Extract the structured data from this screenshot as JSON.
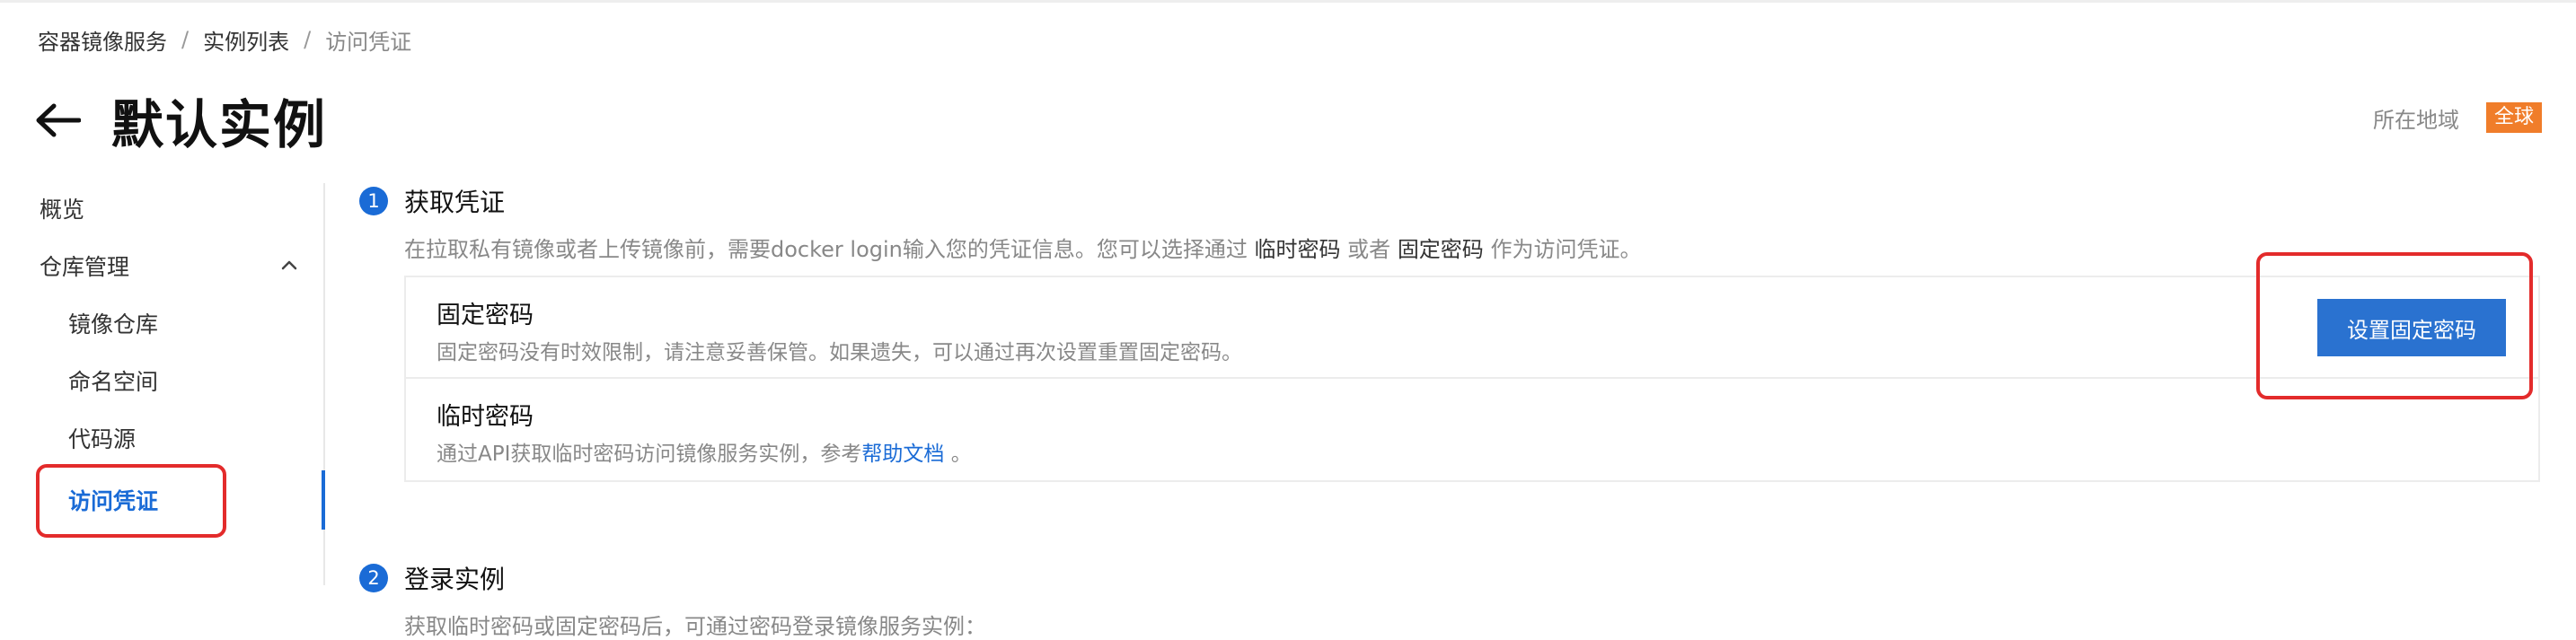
{
  "breadcrumb": [
    "容器镜像服务",
    "实例列表",
    "访问凭证"
  ],
  "header": {
    "title": "默认实例",
    "region_label": "所在地域",
    "region_value": "全球"
  },
  "sidebar": {
    "items": [
      {
        "label": "概览"
      },
      {
        "label": "仓库管理"
      },
      {
        "label": "镜像仓库"
      },
      {
        "label": "命名空间"
      },
      {
        "label": "代码源"
      },
      {
        "label": "访问凭证"
      }
    ]
  },
  "step1": {
    "number": "1",
    "title": "获取凭证",
    "desc_prefix": "在拉取私有镜像或者上传镜像前，需要docker login输入您的凭证信息。您可以选择通过",
    "desc_temp": "临时密码",
    "desc_or": "或者",
    "desc_fixed": "固定密码",
    "desc_suffix": "作为访问凭证。",
    "fixed": {
      "title": "固定密码",
      "desc": "固定密码没有时效限制，请注意妥善保管。如果遗失，可以通过再次设置重置固定密码。",
      "button": "设置固定密码"
    },
    "temp": {
      "title": "临时密码",
      "desc_prefix": "通过API获取临时密码访问镜像服务实例，参考",
      "link": "帮助文档",
      "desc_suffix": "。"
    }
  },
  "step2": {
    "number": "2",
    "title": "登录实例",
    "desc": "获取临时密码或固定密码后，可通过密码登录镜像服务实例："
  },
  "colors": {
    "accent": "#1a6bd6",
    "highlight": "#e32b2b",
    "region_badge": "#f07d2a"
  }
}
